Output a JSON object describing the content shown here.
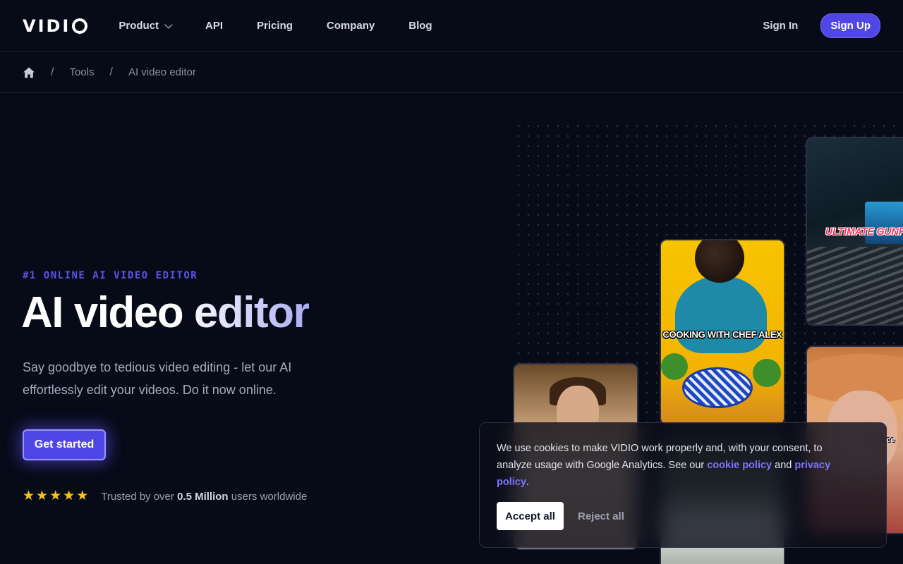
{
  "nav": {
    "logo": "VIDI",
    "links": [
      {
        "label": "Product",
        "dropdown": true
      },
      {
        "label": "API"
      },
      {
        "label": "Pricing"
      },
      {
        "label": "Company"
      },
      {
        "label": "Blog"
      }
    ],
    "sign_in": "Sign In",
    "sign_up": "Sign Up"
  },
  "breadcrumb": {
    "home_icon": "home-icon",
    "separator": "/",
    "items": [
      "Tools",
      "AI video editor"
    ]
  },
  "hero": {
    "eyebrow": "#1 ONLINE AI VIDEO EDITOR",
    "title": "AI video editor",
    "subtitle": "Say goodbye to tedious video editing - let our AI effortlessly edit your videos. Do it now online.",
    "cta": "Get started",
    "rating_stars": 5,
    "trust_prefix": "Trusted by over ",
    "trust_bold": "0.5 Million",
    "trust_suffix": " users worldwide"
  },
  "videos": {
    "gun_caption": "ULTIMATE GUNFIG",
    "chef_caption": "COOKING WITH CHEF ALEX",
    "hat_caption": "e Sce"
  },
  "cookie": {
    "text_before": "We use cookies to make VIDIO work properly and, with your consent, to analyze usage with Google Analytics. See our ",
    "cookie_link": "cookie policy",
    "text_mid": " and ",
    "privacy_link": "privacy policy",
    "text_end": ".",
    "accept": "Accept all",
    "reject": "Reject all"
  },
  "colors": {
    "background": "#070a17",
    "accent": "#5046e5",
    "star": "#f5c518",
    "link": "#7c74ff"
  }
}
